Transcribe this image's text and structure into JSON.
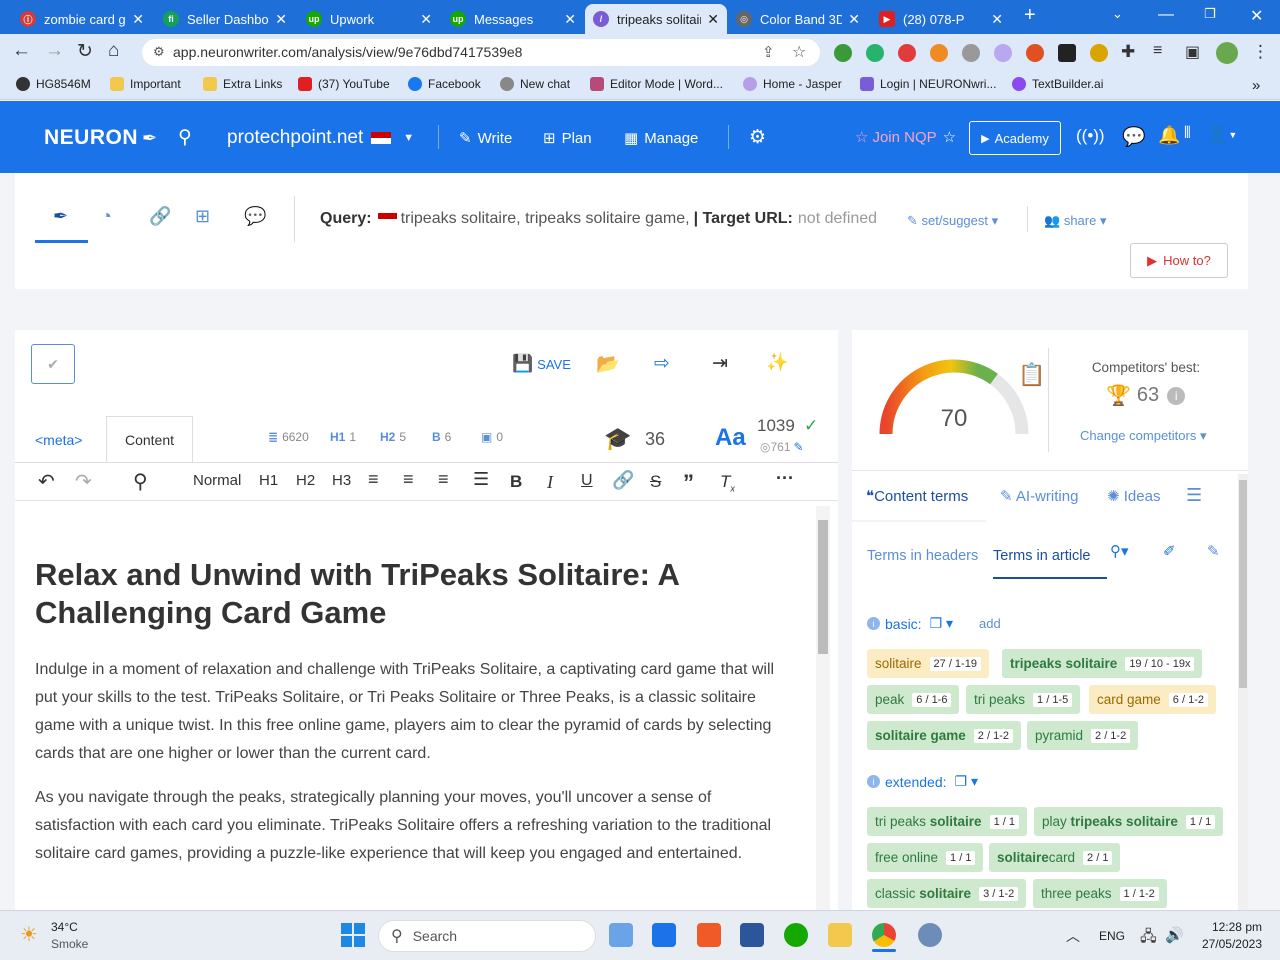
{
  "browser": {
    "tabs": [
      {
        "title": "zombie card game",
        "color": "#d13c3c"
      },
      {
        "title": "Seller Dashboard",
        "color": "#13a05b"
      },
      {
        "title": "Upwork",
        "color": "#14a800"
      },
      {
        "title": "Messages",
        "color": "#14a800"
      },
      {
        "title": "tripeaks solitaire",
        "color": "#7a5cd6"
      },
      {
        "title": "Color Band 3D",
        "color": "#666666"
      },
      {
        "title": "(28) 078-P",
        "color": "#e02020"
      }
    ],
    "url": "app.neuronwriter.com/analysis/view/9e76dbd7417539e8",
    "bookmarks": [
      "HG8546M",
      "Important",
      "Extra Links",
      "(37) YouTube",
      "Facebook",
      "New chat",
      "Editor Mode | Word...",
      "Home - Jasper",
      "Login | NEURONwri...",
      "TextBuilder.ai"
    ]
  },
  "app": {
    "logo": "NEURON",
    "project": "protechpoint.net",
    "nav": [
      "Write",
      "Plan",
      "Manage"
    ],
    "join": "Join NQP",
    "academy": "Academy"
  },
  "query": {
    "label": "Query:",
    "text": "tripeaks solitaire, tripeaks solitaire game,",
    "target_label": "| Target URL:",
    "target_value": "not defined",
    "set_suggest": "set/suggest",
    "share": "share",
    "howto": "How to?"
  },
  "editor": {
    "save": "SAVE",
    "tab_meta": "<meta>",
    "tab_content": "Content",
    "stats": {
      "words": "6620",
      "h1": "1",
      "h2": "5",
      "b": "6",
      "img": "0"
    },
    "readability": "36",
    "chars": "1039",
    "chars_sub": "761",
    "toolbar": [
      "Normal",
      "H1",
      "H2",
      "H3"
    ],
    "title": "Relax and Unwind with TriPeaks Solitaire: A Challenging Card Game",
    "p1": "Indulge in a moment of relaxation and challenge with TriPeaks Solitaire, a captivating card game that will put your skills to the test. TriPeaks Solitaire, or Tri Peaks Solitaire or Three Peaks, is a classic solitaire game with a unique twist. In this free online game, players aim to clear the pyramid of cards by selecting cards that are one higher or lower than the current card.",
    "p2": "As you navigate through the peaks, strategically planning your moves, you'll uncover a sense of satisfaction with each card you eliminate. TriPeaks Solitaire offers a refreshing variation to the traditional solitaire card games, providing a puzzle-like experience that will keep you engaged and entertained."
  },
  "score": {
    "value": "70",
    "value_num": 70,
    "competitors_label": "Competitors' best:",
    "competitors_best": "63",
    "change": "Change competitors"
  },
  "terms": {
    "tabs": [
      "Content terms",
      "AI-writing",
      "Ideas"
    ],
    "subtabs": [
      "Terms in headers",
      "Terms in article"
    ],
    "basic_label": "basic:",
    "add": "add",
    "extended_label": "extended:",
    "basic": [
      {
        "term": "solitaire",
        "count": "27 / 1-19",
        "style": "y"
      },
      {
        "term": "tripeaks solitaire",
        "count": "19 / 10 - 19x",
        "style": "g"
      },
      {
        "term": "peak",
        "count": "6 / 1-6",
        "style": "g"
      },
      {
        "term": "tri peaks",
        "count": "1 / 1-5",
        "style": "g"
      },
      {
        "term": "card game",
        "count": "6 / 1-2",
        "style": "y"
      },
      {
        "term": "solitaire game",
        "count": "2 / 1-2",
        "style": "g"
      },
      {
        "term": "pyramid",
        "count": "2 / 1-2",
        "style": "g"
      }
    ],
    "extended": [
      {
        "pre": "tri peaks ",
        "bold": "solitaire",
        "count": "1 / 1"
      },
      {
        "pre": "play ",
        "bold": "tripeaks solitaire",
        "count": "1 / 1"
      },
      {
        "pre": "free online",
        "bold": "",
        "count": "1 / 1"
      },
      {
        "pre": "",
        "bold": "solitaire",
        "post": " card",
        "count": "2 / 1"
      },
      {
        "pre": "classic ",
        "bold": "solitaire",
        "count": "3 / 1-2"
      },
      {
        "pre": "three peaks",
        "bold": "",
        "count": "1 / 1-2"
      }
    ]
  },
  "taskbar": {
    "temp": "34°C",
    "weather": "Smoke",
    "search": "Search",
    "lang": "ENG",
    "time": "12:28 pm",
    "date": "27/05/2023"
  }
}
